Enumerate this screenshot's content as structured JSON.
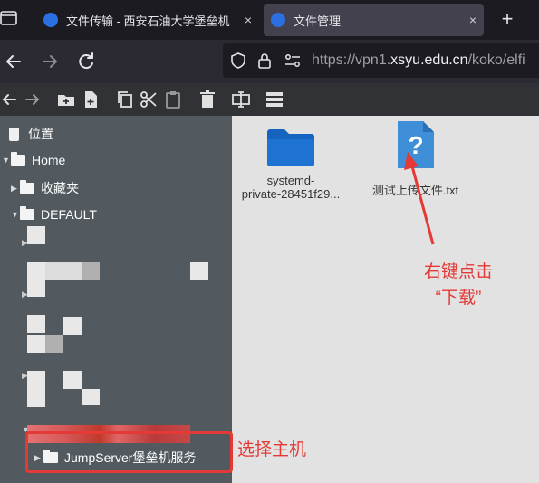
{
  "browser": {
    "tabs": [
      {
        "title": "文件传输 - 西安石油大学堡垒机",
        "close": "×",
        "active": false
      },
      {
        "title": "文件管理",
        "close": "×",
        "active": true
      }
    ],
    "new_tab": "+",
    "url_host": "https://vpn1.",
    "url_domain": "xsyu.edu.cn",
    "url_path": "/koko/elfi"
  },
  "toolbar": {
    "icons": [
      "back-icon",
      "forward-icon",
      "new-folder-icon",
      "new-file-icon",
      "copy-icon",
      "cut-icon",
      "paste-icon",
      "delete-icon",
      "rename-icon",
      "view-list-icon"
    ]
  },
  "sidebar": {
    "places_label": "位置",
    "home_label": "Home",
    "favorites_label": "收藏夹",
    "default_label": "DEFAULT",
    "jumpserver_label": "JumpServer堡垒机服务"
  },
  "files": [
    {
      "name_line1": "systemd-",
      "name_line2": "private-28451f29...",
      "icon": "folder-icon",
      "color": "#1565c0"
    },
    {
      "name_line1": "测试上传文件.txt",
      "name_line2": "",
      "icon": "unknown-file-icon",
      "color": "#3f8fd8"
    }
  ],
  "annotations": {
    "download_line1": "右键点击",
    "download_line2": "“下载”",
    "select_host": "选择主机",
    "accent": "#e53935"
  }
}
